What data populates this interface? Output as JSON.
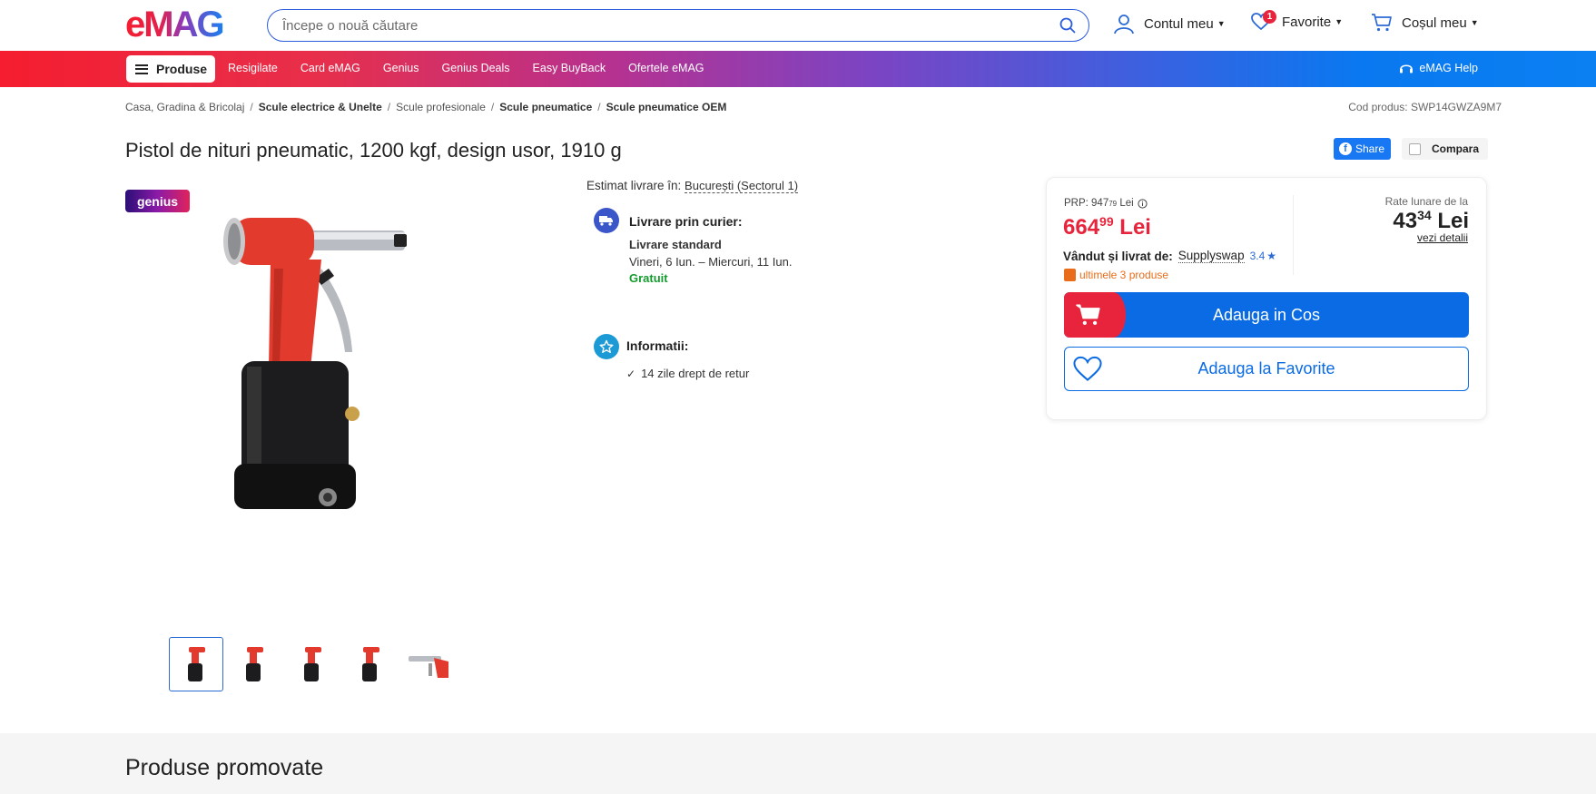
{
  "header": {
    "logo_text": "eMAG",
    "search_placeholder": "Începe o nouă căutare",
    "account_label": "Contul meu",
    "favorites_label": "Favorite",
    "favorites_count": "1",
    "cart_label": "Coșul meu"
  },
  "nav": {
    "produse_label": "Produse",
    "links": [
      "Resigilate",
      "Card eMAG",
      "Genius",
      "Genius Deals",
      "Easy BuyBack",
      "Ofertele eMAG"
    ],
    "help_label": "eMAG Help"
  },
  "breadcrumb": {
    "items": [
      "Casa, Gradina & Bricolaj",
      "Scule electrice & Unelte",
      "Scule profesionale",
      "Scule pneumatice",
      "Scule pneumatice OEM"
    ]
  },
  "product": {
    "code_label": "Cod produs: SWP14GWZA9M7",
    "title": "Pistol de nituri pneumatic, 1200 kgf, design usor, 1910 g",
    "share_label": "Share",
    "compara_label": "Compara",
    "genius_badge": "genius"
  },
  "delivery": {
    "estimat_label": "Estimat livrare în:",
    "city": "București (Sectorul 1)",
    "courier_title": "Livrare prin curier:",
    "standard": "Livrare standard",
    "dates": "Vineri, 6 Iun. – Miercuri, 11 Iun.",
    "free": "Gratuit",
    "info_title": "Informatii:",
    "return": "14 zile drept de retur"
  },
  "buybox": {
    "prp_label": "PRP: 947",
    "prp_decimals": "79",
    "prp_currency": "Lei",
    "price_int": "664",
    "price_dec": "99",
    "price_currency": "Lei",
    "sold_by_label": "Vândut și livrat de:",
    "seller_name": "Supplyswap",
    "seller_rating": "3.4",
    "last_products": "ultimele 3 produse",
    "rate_label": "Rate lunare de la",
    "rate_int": "43",
    "rate_dec": "34",
    "rate_currency": "Lei",
    "rate_details": "vezi detalii",
    "add_cart": "Adauga in Cos",
    "add_fav": "Adauga la Favorite"
  },
  "promo": {
    "title": "Produse promovate"
  },
  "colors": {
    "brand_red": "#e8243c",
    "brand_blue": "#0a6be4",
    "green": "#159b2f",
    "orange": "#e86c19"
  }
}
